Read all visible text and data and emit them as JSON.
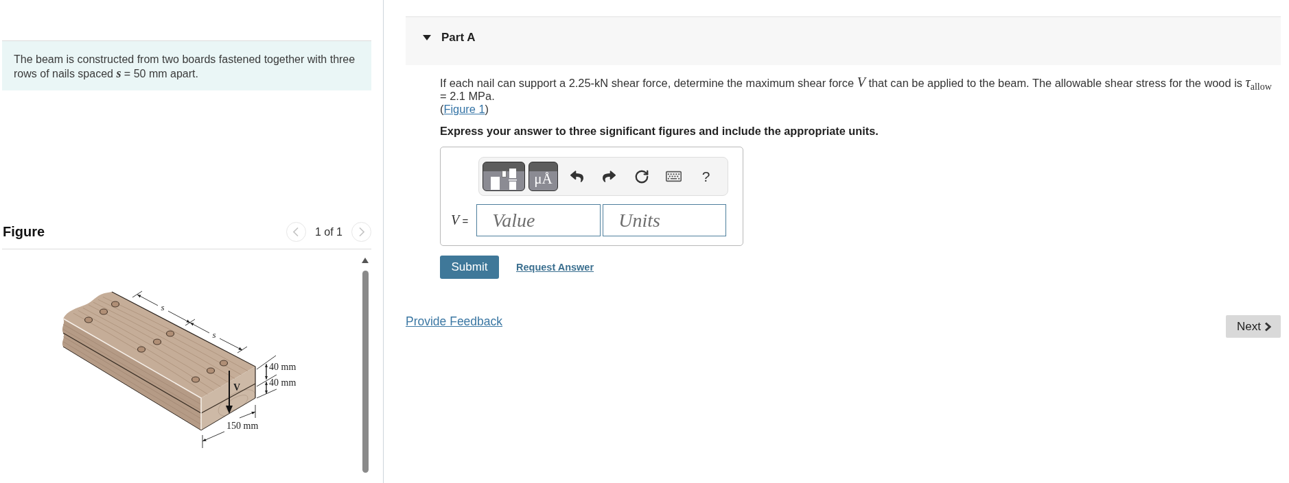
{
  "problem": {
    "text": "The beam is constructed from two boards fastened together with three rows of nails spaced *s* = 50 mm apart."
  },
  "figure": {
    "title": "Figure",
    "pager": {
      "text": "1 of 1",
      "prev_disabled": true,
      "next_disabled": true
    },
    "drawing": {
      "spacing_labels": [
        "s",
        "s"
      ],
      "thickness_labels": [
        "40 mm",
        "40 mm"
      ],
      "width_label": "150 mm",
      "force_label": "V"
    }
  },
  "part": {
    "title": "Part A",
    "expanded": true,
    "question": "If each nail can support a 2.25-kN shear force, determine the maximum shear force *V* that can be applied to the beam. The allowable shear stress for the wood is *τ*$_{allow}$ = 2.1 MPa.",
    "figure_link": {
      "open": "(",
      "label": "Figure 1",
      "close": ")"
    },
    "instruction": "Express your answer to three significant figures and include the appropriate units.",
    "answer": {
      "toolbar": [
        {
          "kind": "templates"
        },
        {
          "kind": "symbols",
          "label": "μÅ"
        },
        {
          "kind": "undo"
        },
        {
          "kind": "redo"
        },
        {
          "kind": "reset"
        },
        {
          "kind": "keyboard"
        },
        {
          "kind": "help",
          "label": "?"
        }
      ],
      "variable": "*V* =",
      "value": {
        "placeholder": "Value"
      },
      "units": {
        "placeholder": "Units"
      }
    },
    "submit": "Submit",
    "request_answer": "Request Answer"
  },
  "feedback_link": "Provide Feedback",
  "next_button": "Next"
}
